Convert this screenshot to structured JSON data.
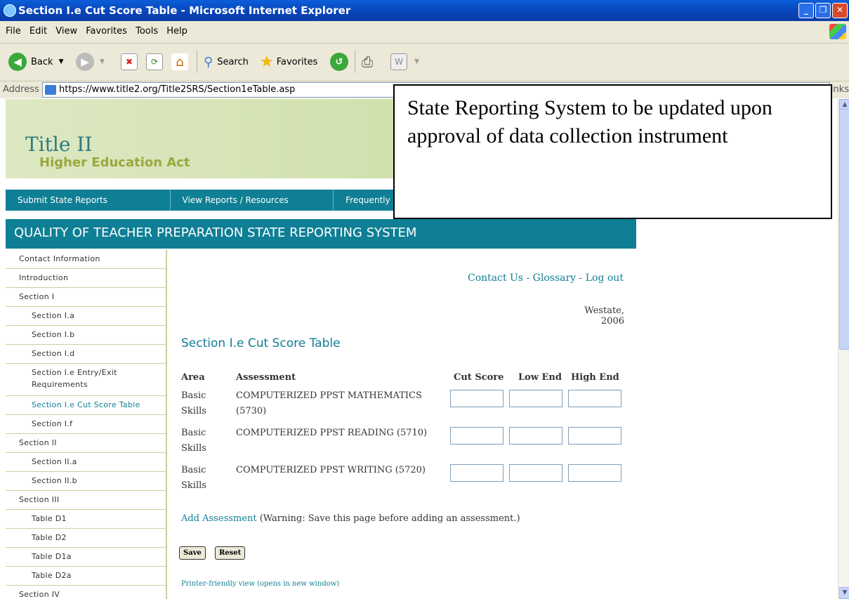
{
  "window": {
    "title": "Section I.e Cut Score Table - Microsoft Internet Explorer"
  },
  "menu": [
    "File",
    "Edit",
    "View",
    "Favorites",
    "Tools",
    "Help"
  ],
  "toolbar": {
    "back": "Back",
    "search": "Search",
    "favorites": "Favorites"
  },
  "address": {
    "label": "Address",
    "url": "https://www.title2.org/Title2SRS/Section1eTable.asp",
    "links": "Links"
  },
  "banner": {
    "line1": "Title II",
    "line2": "Higher Education Act"
  },
  "nav": {
    "items": [
      "Submit State Reports",
      "View Reports / Resources",
      "Frequently Asked Questions"
    ]
  },
  "system_title": "QUALITY OF TEACHER PREPARATION STATE REPORTING SYSTEM",
  "sidebar": {
    "items": [
      "Contact Information",
      "Introduction",
      "Section I",
      "Section I.a",
      "Section I.b",
      "Section I.d",
      "Section I.e Entry/Exit Requirements",
      "Section I.e Cut Score Table",
      "Section I.f",
      "Section II",
      "Section II.a",
      "Section II.b",
      "Section III",
      "Table D1",
      "Table D2",
      "Table D1a",
      "Table D2a",
      "Section IV"
    ]
  },
  "top_links": {
    "contact": "Contact Us",
    "glossary": "Glossary",
    "logout": "Log out",
    "sep": " - "
  },
  "state_year": "Westate, 2006",
  "page_title": "Section I.e Cut Score Table",
  "table": {
    "headers": {
      "area": "Area",
      "assessment": "Assessment",
      "cut": "Cut Score",
      "low": "Low End",
      "high": "High End"
    },
    "rows": [
      {
        "area1": "Basic",
        "area2": "Skills",
        "assessment1": "COMPUTERIZED PPST MATHEMATICS",
        "assessment2": "(5730)"
      },
      {
        "area1": "Basic",
        "area2": "Skills",
        "assessment1": "COMPUTERIZED PPST READING (5710)",
        "assessment2": ""
      },
      {
        "area1": "Basic",
        "area2": "Skills",
        "assessment1": "COMPUTERIZED PPST WRITING (5720)",
        "assessment2": ""
      }
    ]
  },
  "add_assessment": {
    "link": "Add Assessment",
    "warning": " (Warning: Save this page before adding an assessment.)"
  },
  "buttons": {
    "save": "Save",
    "reset": "Reset"
  },
  "printer_link": "Printer-friendly view (opens in new window)",
  "overlay_note": "State Reporting System to be updated upon approval of data collection instrument"
}
